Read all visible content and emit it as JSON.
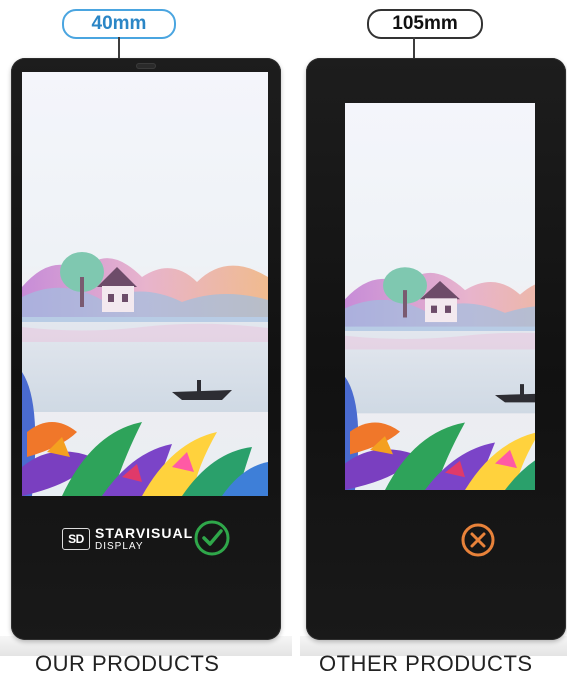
{
  "comparison": {
    "left": {
      "thickness_label": "40mm",
      "brand_logo_initials": "SD",
      "brand_name": "STARVISUAL",
      "brand_subtitle": "DISPLAY",
      "verdict_icon": "check-circle-icon",
      "caption": "OUR PRODUCTS"
    },
    "right": {
      "thickness_label": "105mm",
      "verdict_icon": "x-circle-icon",
      "caption": "OTHER PRODUCTS"
    }
  },
  "colors": {
    "left_label_border": "#4aa5e0",
    "left_label_text": "#2b86c6",
    "check_green": "#2fa74a",
    "cross_orange": "#e8823a",
    "device_body": "#151515"
  }
}
